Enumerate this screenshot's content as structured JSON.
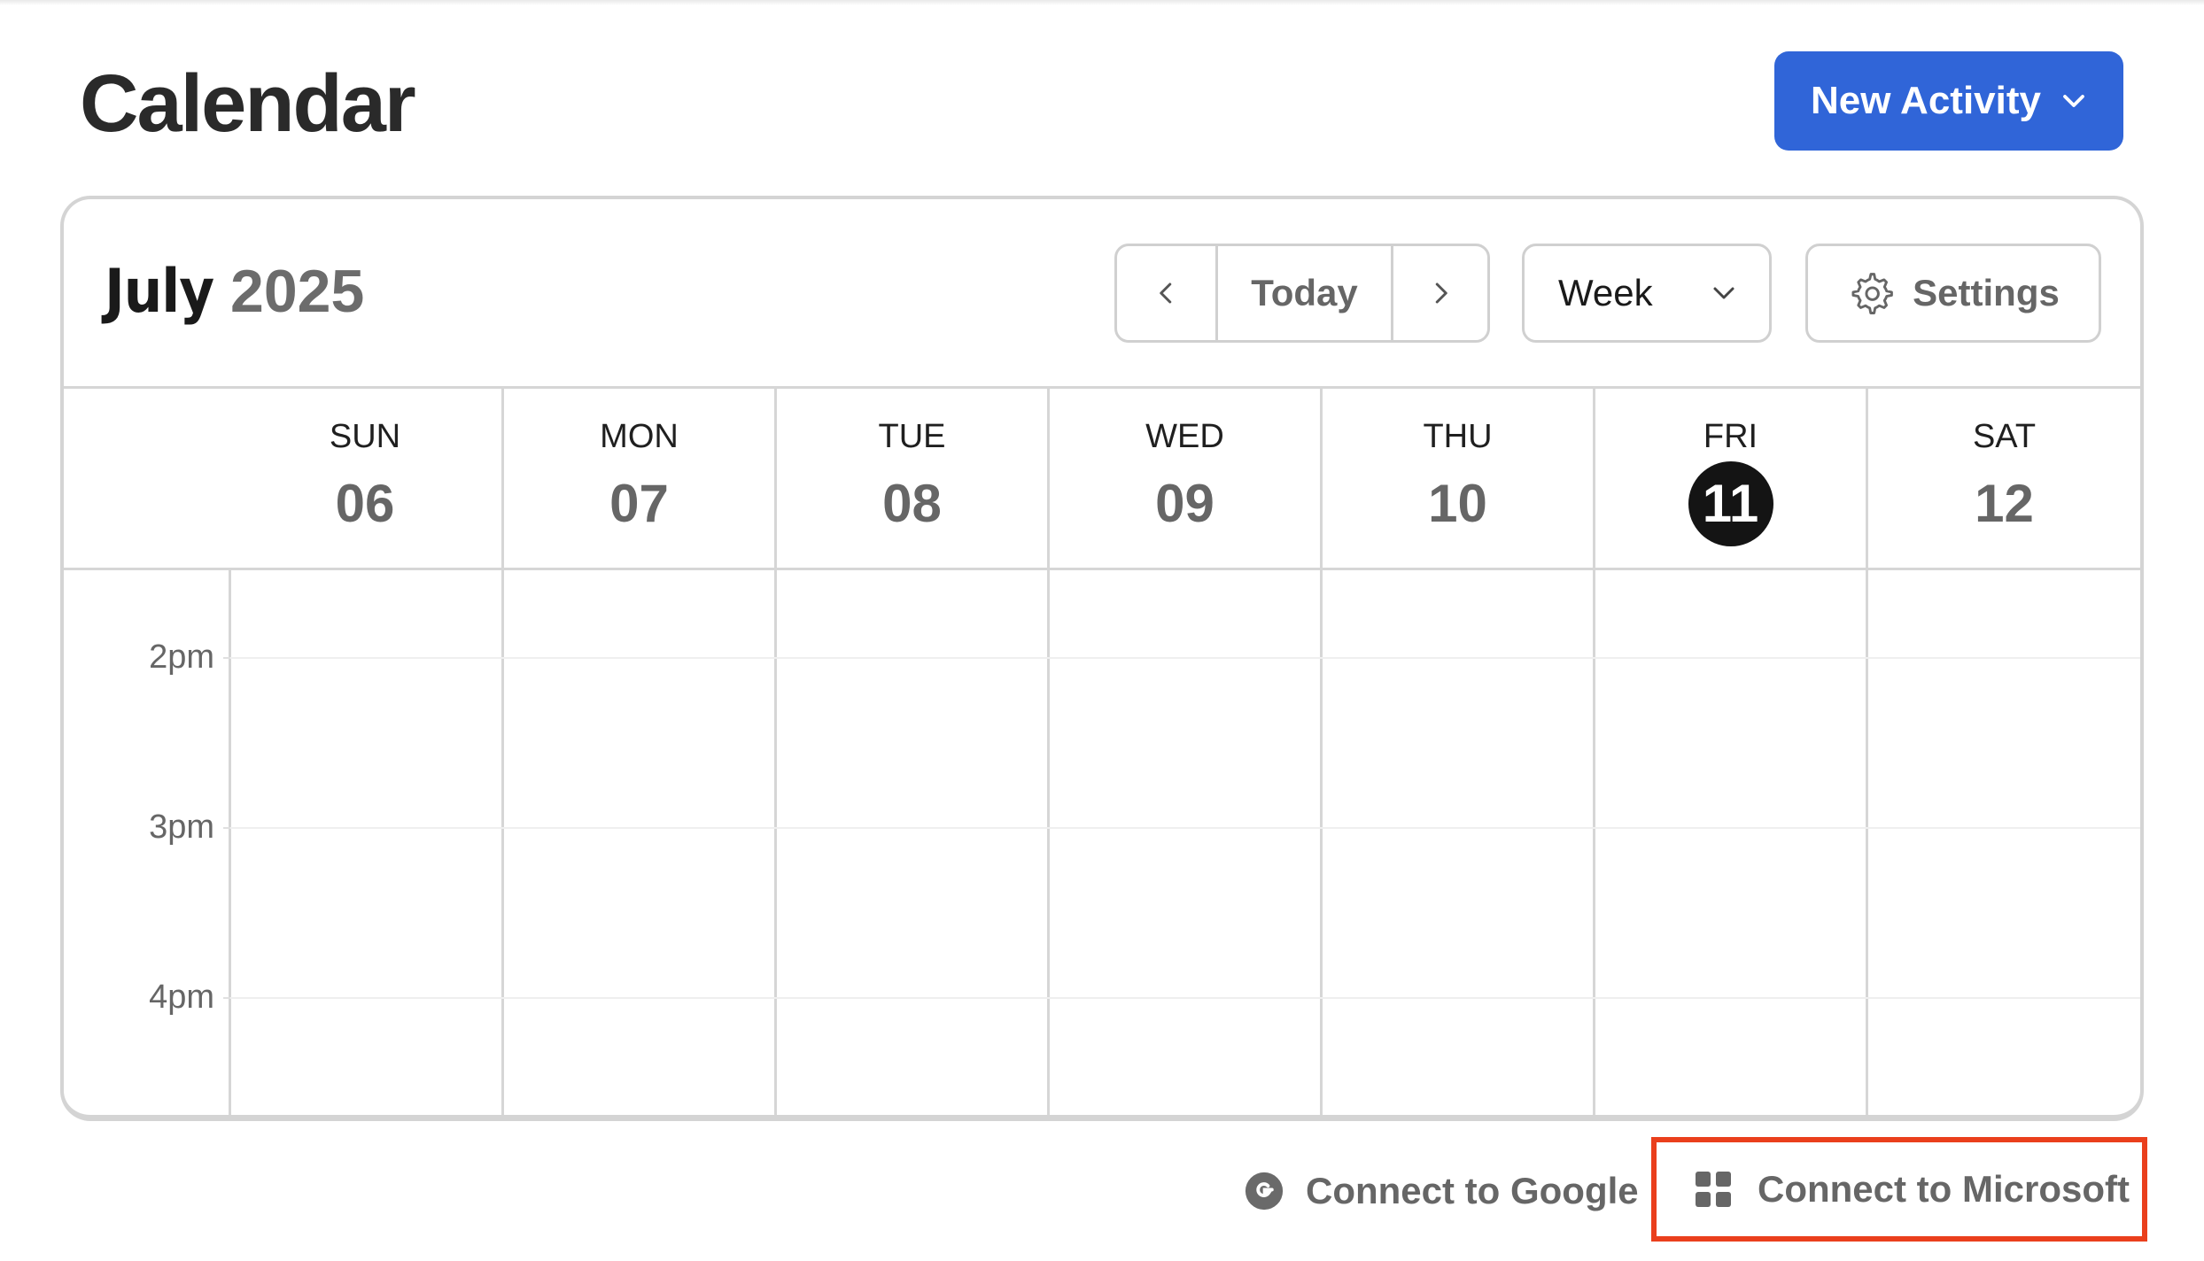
{
  "header": {
    "title": "Calendar",
    "new_activity_label": "New Activity"
  },
  "toolbar": {
    "month": "July",
    "year": "2025",
    "today_label": "Today",
    "view_selected": "Week",
    "settings_label": "Settings"
  },
  "week": {
    "days": [
      {
        "name": "SUN",
        "num": "06"
      },
      {
        "name": "MON",
        "num": "07"
      },
      {
        "name": "TUE",
        "num": "08"
      },
      {
        "name": "WED",
        "num": "09"
      },
      {
        "name": "THU",
        "num": "10"
      },
      {
        "name": "FRI",
        "num": "11"
      },
      {
        "name": "SAT",
        "num": "12"
      }
    ],
    "today_index": 5
  },
  "hours": [
    "2pm",
    "3pm",
    "4pm"
  ],
  "footer": {
    "google_label": "Connect to Google",
    "microsoft_label": "Connect to Microsoft"
  },
  "colors": {
    "primary": "#3065d8",
    "today_bg": "#141414",
    "highlight": "#ea3f1c"
  },
  "icons": {
    "prev": "chevron-left-icon",
    "next": "chevron-right-icon",
    "dropdown": "chevron-down-icon",
    "settings": "gear-icon",
    "google": "google-icon",
    "microsoft": "microsoft-icon"
  }
}
